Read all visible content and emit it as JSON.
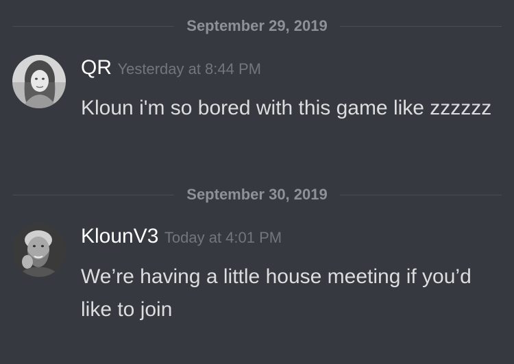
{
  "colors": {
    "background": "#36393f",
    "username": "#ffffff",
    "message_text": "#dcddde",
    "timestamp": "#72767d",
    "date_divider": "#8e9297"
  },
  "dividers": [
    {
      "date": "September 29, 2019"
    },
    {
      "date": "September 30, 2019"
    }
  ],
  "messages": [
    {
      "username": "QR",
      "timestamp": "Yesterday at 8:44 PM",
      "text": "Kloun i'm so bored with this game like zzzzzz",
      "avatar_icon": "user-avatar-woman"
    },
    {
      "username": "KlounV3",
      "timestamp": "Today at 4:01 PM",
      "text": "We’re having a little house meeting if you’d like to join",
      "avatar_icon": "user-avatar-man"
    }
  ]
}
